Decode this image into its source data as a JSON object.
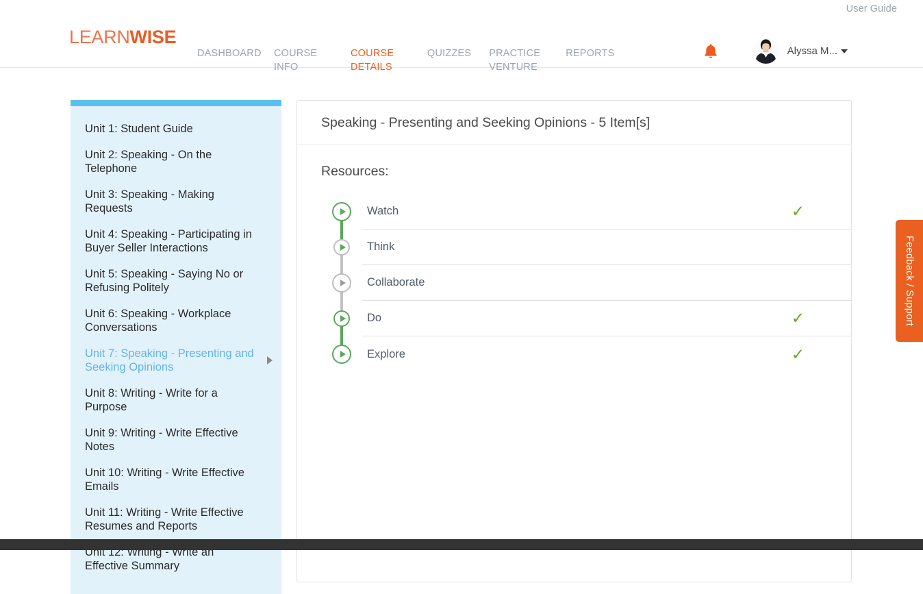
{
  "utility": {
    "user_guide_label": "User Guide"
  },
  "header": {
    "logo": {
      "part1": "LEARN",
      "part2": "WISE"
    },
    "nav": [
      {
        "label": "DASHBOARD",
        "active": false
      },
      {
        "label": "COURSE INFO",
        "active": false
      },
      {
        "label": "COURSE DETAILS",
        "active": true
      },
      {
        "label": "QUIZZES",
        "active": false
      },
      {
        "label": "PRACTICE VENTURE",
        "active": false
      },
      {
        "label": "REPORTS",
        "active": false
      }
    ],
    "notification_icon": "bell-icon",
    "user_name": "Alyssa M...",
    "avatar_icon": "avatar-photo"
  },
  "sidebar": {
    "items": [
      {
        "label": "Unit 1: Student Guide",
        "selected": false
      },
      {
        "label": "Unit 2: Speaking - On the Telephone",
        "selected": false
      },
      {
        "label": "Unit 3: Speaking - Making Requests",
        "selected": false
      },
      {
        "label": "Unit 4: Speaking - Participating in Buyer Seller Interactions",
        "selected": false
      },
      {
        "label": "Unit 5: Speaking - Saying No or Refusing Politely",
        "selected": false
      },
      {
        "label": "Unit 6: Speaking - Workplace Conversations",
        "selected": false
      },
      {
        "label": "Unit 7: Speaking - Presenting and Seeking Opinions",
        "selected": true
      },
      {
        "label": "Unit 8: Writing - Write for a Purpose",
        "selected": false
      },
      {
        "label": "Unit 9: Writing - Write Effective Notes",
        "selected": false
      },
      {
        "label": "Unit 10: Writing - Write Effective Emails",
        "selected": false
      },
      {
        "label": "Unit 11: Writing - Write Effective Resumes and Reports",
        "selected": false
      },
      {
        "label": "Unit 12: Writing - Write an Effective Summary",
        "selected": false
      }
    ]
  },
  "main": {
    "card_title": "Speaking - Presenting and Seeking Opinions - 5 Item[s]",
    "resources_label": "Resources:",
    "resources": [
      {
        "label": "Watch",
        "completed": true,
        "ring": "green",
        "triangle": "green",
        "line_above": "none",
        "line_below": "green"
      },
      {
        "label": "Think",
        "completed": false,
        "ring": "gray",
        "triangle": "green",
        "line_above": "green",
        "line_below": "gray"
      },
      {
        "label": "Collaborate",
        "completed": false,
        "ring": "gray",
        "triangle": "gray",
        "line_above": "gray",
        "line_below": "gray"
      },
      {
        "label": "Do",
        "completed": true,
        "ring": "green",
        "triangle": "green",
        "line_above": "gray",
        "line_below": "green"
      },
      {
        "label": "Explore",
        "completed": true,
        "ring": "green",
        "triangle": "green",
        "line_above": "green",
        "line_below": "none"
      }
    ],
    "check_glyph": "✓"
  },
  "feedback": {
    "label": "Feedback / Support"
  },
  "colors": {
    "brand_orange": "#ec5b22",
    "accent_blue": "#5bc0f0",
    "sidebar_bg": "#e1f2fb",
    "selected_item": "#66b3e8",
    "progress_green": "#5aa95a",
    "check_green": "#64aa22",
    "inactive_gray": "#bdbdbd",
    "footer_dark": "#333333"
  }
}
